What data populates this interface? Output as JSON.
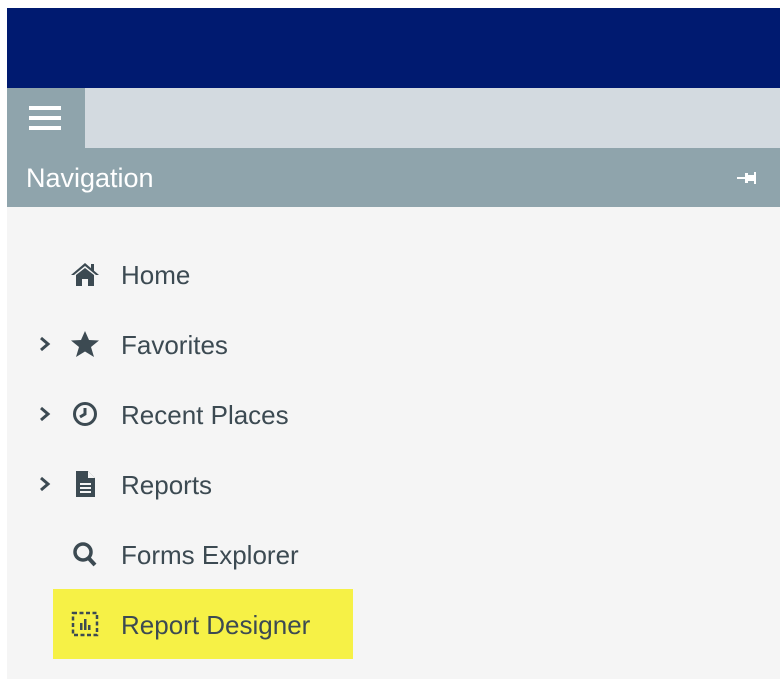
{
  "header": {
    "banner_color": "#001a70",
    "toolbar_color": "#d3dae0",
    "menu_icon": "hamburger-menu-icon"
  },
  "navigation": {
    "title": "Navigation",
    "pin_icon": "pin-icon",
    "header_color": "#8fa4ac",
    "items": [
      {
        "label": "Home",
        "icon": "home-icon",
        "expandable": false
      },
      {
        "label": "Favorites",
        "icon": "star-icon",
        "expandable": true
      },
      {
        "label": "Recent Places",
        "icon": "clock-icon",
        "expandable": true
      },
      {
        "label": "Reports",
        "icon": "document-icon",
        "expandable": true
      },
      {
        "label": "Forms Explorer",
        "icon": "search-icon",
        "expandable": false
      },
      {
        "label": "Report Designer",
        "icon": "report-designer-icon",
        "expandable": false,
        "highlighted": true
      }
    ]
  },
  "colors": {
    "text": "#3c4a52",
    "highlight": "#f6f146",
    "panel_background": "#f5f5f5"
  }
}
